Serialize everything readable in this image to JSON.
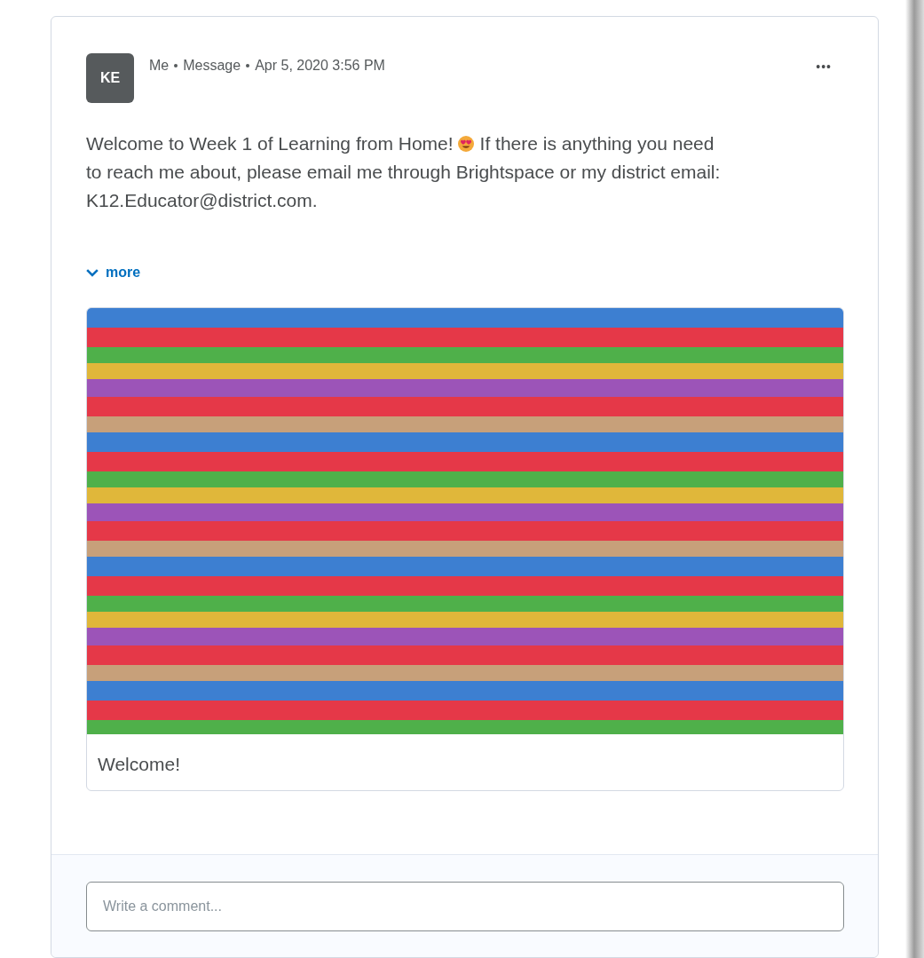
{
  "post": {
    "avatar": "KE",
    "meta": [
      "Me",
      "Message",
      "Apr 5, 2020 3:56 PM"
    ],
    "menu": "•••",
    "body_before": "Welcome to Week 1 of Learning from Home!",
    "body_after": "If there is anything you need",
    "body_rest": "to reach me about,  please email me through Brightspace or my district email: K12.Educator@district.com.",
    "more": "more",
    "attachment": {
      "caption": "Welcome!"
    }
  },
  "comment": {
    "placeholder": "Write a comment..."
  }
}
